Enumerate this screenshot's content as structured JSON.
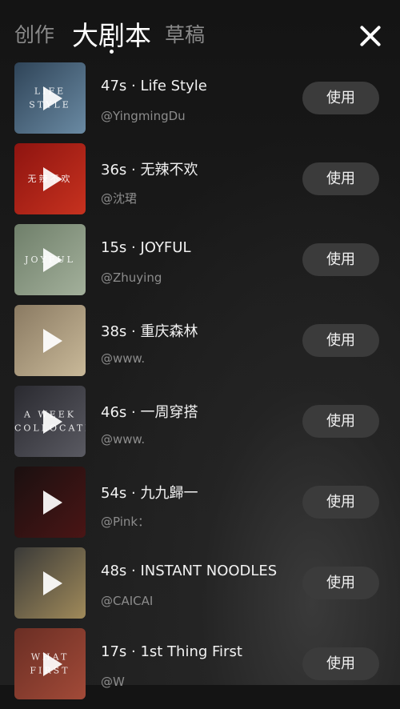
{
  "tabs": [
    {
      "label": "创作"
    },
    {
      "label": "大剧本"
    },
    {
      "label": "草稿"
    }
  ],
  "close_icon": "close-icon",
  "use_label": "使用",
  "items": [
    {
      "title": "47s · Life Style",
      "author": "@YingmingDu",
      "thumb_text": "LIFE STYLE",
      "thumb_colors": [
        "#2f4458",
        "#6a8aa3"
      ]
    },
    {
      "title": "36s · 无辣不欢",
      "author": "@沈珺",
      "thumb_text": "无辣不欢",
      "thumb_colors": [
        "#8e1410",
        "#c7321f"
      ]
    },
    {
      "title": "15s · JOYFUL",
      "author": "@Zhuying",
      "thumb_text": "JOYFUL",
      "thumb_colors": [
        "#6f7f6a",
        "#a3b09b"
      ]
    },
    {
      "title": "38s · 重庆森林",
      "author": "@www.",
      "thumb_text": "",
      "thumb_colors": [
        "#8a7a62",
        "#c9b999"
      ]
    },
    {
      "title": "46s · 一周穿搭",
      "author": "@www.",
      "thumb_text": "A WEEK COLLOCATION",
      "thumb_colors": [
        "#2a2a30",
        "#5a5a62"
      ]
    },
    {
      "title": "54s · 九九歸一",
      "author": "@Pink：",
      "thumb_text": "",
      "thumb_colors": [
        "#1a1010",
        "#4a1515"
      ]
    },
    {
      "title": "48s · INSTANT NOODLES",
      "author": "@CAICAI",
      "thumb_text": "",
      "thumb_colors": [
        "#3a3a38",
        "#a08a5a"
      ]
    },
    {
      "title": "17s · 1st Thing First",
      "author": "@W",
      "thumb_text": "WHAT FIRST",
      "thumb_colors": [
        "#6a2e24",
        "#a24a38"
      ]
    }
  ]
}
